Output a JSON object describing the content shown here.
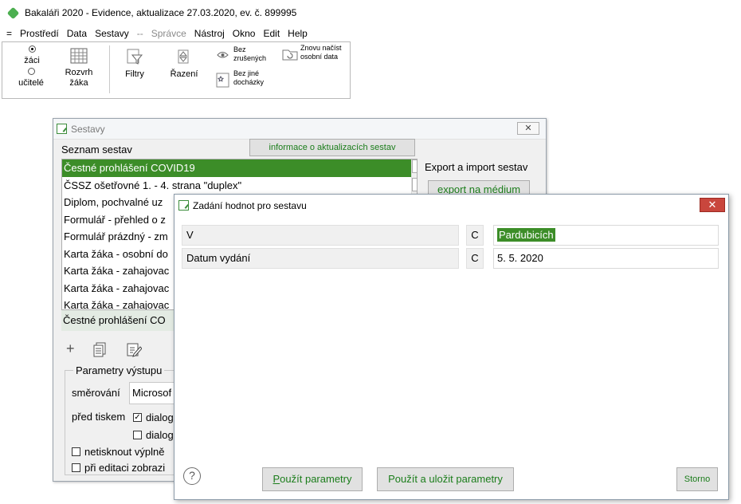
{
  "app": {
    "title": "Bakaláři 2020 - Evidence, aktualizace 27.03.2020, ev. č. 899995"
  },
  "menu": {
    "items": [
      "=",
      "Prostředí",
      "Data",
      "Sestavy",
      "--",
      "Správce",
      "Nástroj",
      "Okno",
      "Edit",
      "Help"
    ]
  },
  "toolbar": {
    "radio_zaci": "žáci",
    "radio_ucitele": "učitelé",
    "rozvrh_1": "Rozvrh",
    "rozvrh_2": "žáka",
    "filtry": "Filtry",
    "razeni": "Řazení",
    "bez_zrusenych_1": "Bez",
    "bez_zrusenych_2": "zrušených",
    "znovu_1": "Znovu načíst",
    "znovu_2": "osobní data",
    "bez_jine_1": "Bez jiné",
    "bez_jine_2": "docházky"
  },
  "sestavy": {
    "title": "Sestavy",
    "close": "✕",
    "seznam_label": "Seznam sestav",
    "info_button": "informace o aktualizacích sestav",
    "export_label": "Export a import sestav",
    "export_button": "export na médium",
    "items": [
      "Čestné prohlášení COVID19",
      "ČSSZ ošetřovné 1. - 4. strana \"duplex\"",
      "Diplom, pochvalné uz",
      "Formulář - přehled o z",
      "Formulář prázdný - zm",
      "Karta žáka - osobní do",
      "Karta žáka - zahajovac",
      "Karta žáka - zahajovac",
      "Karta žáka - zahajovac"
    ],
    "selected_name": "Čestné prohlášení CO",
    "params_legend": "Parametry výstupu",
    "smerovani_label": "směrování",
    "smerovani_value": "Microsof",
    "pred_tiskem_label": "před tiskem",
    "dialog1": "dialog",
    "dialog2": "dialog",
    "netisknout": "netisknout výplně",
    "pri_editaci": "při editaci zobrazi"
  },
  "zadani": {
    "title": "Zadání hodnot pro sestavu",
    "close": "✕",
    "rows": [
      {
        "label": "V",
        "c": "C",
        "value": "Pardubicích"
      },
      {
        "label": "Datum vydání",
        "c": "C",
        "value": "5. 5. 2020"
      }
    ],
    "help": "?",
    "btn_pouzit_first": "P",
    "btn_pouzit_rest": "oužít parametry",
    "btn_pouzit_ulozit": "Použít a uložit parametry",
    "btn_storno": "Storno"
  },
  "colors": {
    "accent_green": "#3c8d28",
    "button_text_green": "#1b7d1b",
    "close_red": "#c9463d"
  }
}
